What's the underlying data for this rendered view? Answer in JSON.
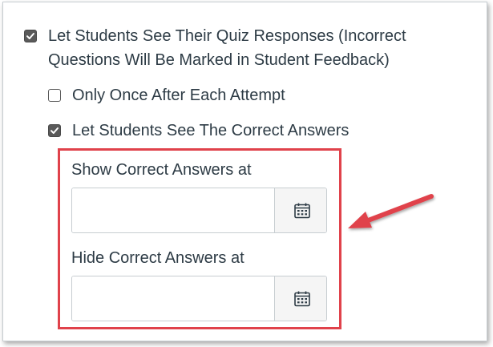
{
  "options": {
    "see_responses": {
      "label": "Let Students See Their Quiz Responses (Incorrect Questions Will Be Marked in Student Feedback)",
      "checked": true
    },
    "only_once": {
      "label": "Only Once After Each Attempt",
      "checked": false
    },
    "see_correct": {
      "label": "Let Students See The Correct Answers",
      "checked": true
    }
  },
  "show_correct": {
    "label": "Show Correct Answers at",
    "value": "",
    "icon": "calendar-icon"
  },
  "hide_correct": {
    "label": "Hide Correct Answers at",
    "value": "",
    "icon": "calendar-icon"
  },
  "colors": {
    "highlight": "#e0424b",
    "arrow": "#e0424b",
    "text": "#2d3b45"
  }
}
